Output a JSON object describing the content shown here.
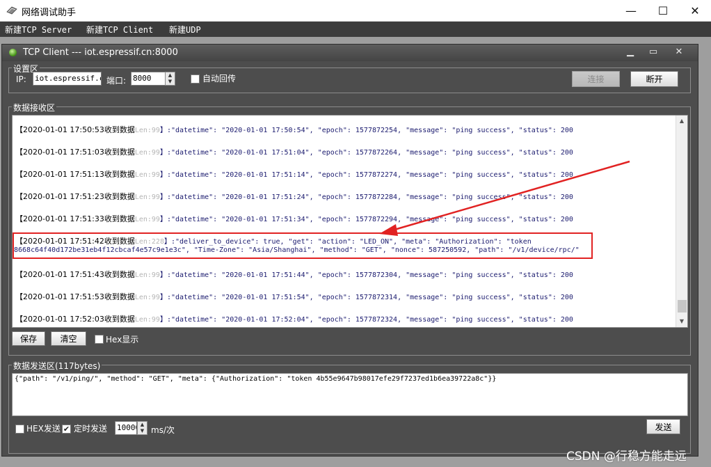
{
  "window": {
    "title": "网络调试助手",
    "min_symbol": "—",
    "max_symbol": "☐",
    "close_symbol": "✕"
  },
  "menu": {
    "items": [
      "新建TCP Server",
      "新建TCP Client",
      "新建UDP"
    ]
  },
  "child": {
    "caption": "TCP Client --- iot.espressif.cn:8000",
    "min_symbol": "▁",
    "max_symbol": "▭",
    "close_symbol": "✕"
  },
  "settings": {
    "legend": "设置区",
    "ip_label": "IP:",
    "ip_value": "iot.espressif.cn",
    "port_label": "端口:",
    "port_value": "8000",
    "auto_echo_label": "自动回传",
    "connect_label": "连接",
    "disconnect_label": "断开"
  },
  "receive": {
    "legend": "数据接收区",
    "lines": [
      {
        "ts": "【2020-01-01 17:50:53收到数据",
        "len": "Len:99",
        "payload": "】:\"datetime\": \"2020-01-01 17:50:54\", \"epoch\": 1577872254, \"message\": \"ping success\", \"status\": 200"
      },
      {
        "ts": "【2020-01-01 17:51:03收到数据",
        "len": "Len:99",
        "payload": "】:\"datetime\": \"2020-01-01 17:51:04\", \"epoch\": 1577872264, \"message\": \"ping success\", \"status\": 200"
      },
      {
        "ts": "【2020-01-01 17:51:13收到数据",
        "len": "Len:99",
        "payload": "】:\"datetime\": \"2020-01-01 17:51:14\", \"epoch\": 1577872274, \"message\": \"ping success\", \"status\": 200"
      },
      {
        "ts": "【2020-01-01 17:51:23收到数据",
        "len": "Len:99",
        "payload": "】:\"datetime\": \"2020-01-01 17:51:24\", \"epoch\": 1577872284, \"message\": \"ping success\", \"status\": 200"
      },
      {
        "ts": "【2020-01-01 17:51:33收到数据",
        "len": "Len:99",
        "payload": "】:\"datetime\": \"2020-01-01 17:51:34\", \"epoch\": 1577872294, \"message\": \"ping success\", \"status\": 200"
      },
      {
        "ts": "【2020-01-01 17:51:42收到数据",
        "len": "Len:228",
        "payload": "】:\"deliver_to_device\": true, \"get\": \"action\": \"LED_ON\", \"meta\": \"Authorization\": \"token",
        "payload2": "8668c64f40d172be31eb4f12cbcaf4e57c9e1e3c\", \"Time-Zone\": \"Asia/Shanghai\", \"method\": \"GET\", \"nonce\": 587250592, \"path\": \"/v1/device/rpc/\""
      },
      {
        "ts": "【2020-01-01 17:51:43收到数据",
        "len": "Len:99",
        "payload": "】:\"datetime\": \"2020-01-01 17:51:44\", \"epoch\": 1577872304, \"message\": \"ping success\", \"status\": 200"
      },
      {
        "ts": "【2020-01-01 17:51:53收到数据",
        "len": "Len:99",
        "payload": "】:\"datetime\": \"2020-01-01 17:51:54\", \"epoch\": 1577872314, \"message\": \"ping success\", \"status\": 200"
      },
      {
        "ts": "【2020-01-01 17:52:03收到数据",
        "len": "Len:99",
        "payload": "】:\"datetime\": \"2020-01-01 17:52:04\", \"epoch\": 1577872324, \"message\": \"ping success\", \"status\": 200"
      }
    ],
    "save_label": "保存",
    "clear_label": "清空",
    "hex_label": "Hex显示"
  },
  "send": {
    "legend": "数据发送区(117bytes)",
    "text": "{\"path\": \"/v1/ping/\", \"method\": \"GET\", \"meta\": {\"Authorization\": \"token 4b55e9647b98017efe29f7237ed1b6ea39722a8c\"}}",
    "hex_label": "HEX发送",
    "timer_label": "定时发送",
    "interval_value": "10000",
    "interval_unit": "ms/次",
    "send_label": "发送",
    "timer_checked": "✔"
  },
  "watermark": "CSDN @行稳方能走远",
  "colors": {
    "highlight": "#e12222",
    "menubar": "#3c3c3c",
    "panel": "#4d4d4d"
  }
}
